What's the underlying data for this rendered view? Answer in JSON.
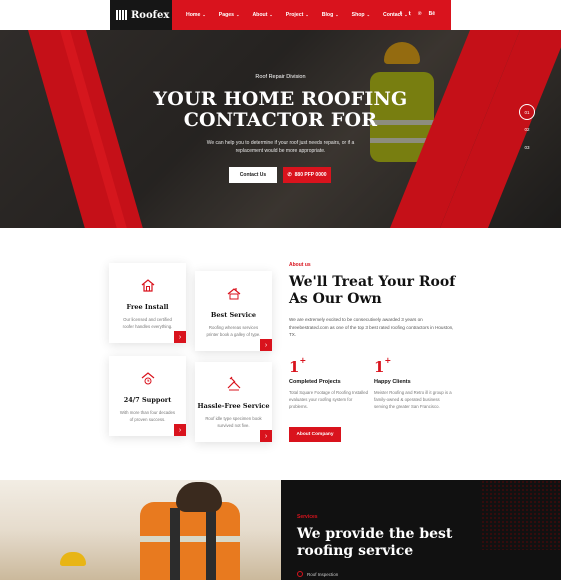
{
  "brand": {
    "name": "Roofex",
    "accent": "#d9131d"
  },
  "nav": {
    "items": [
      {
        "label": "Home"
      },
      {
        "label": "Pages"
      },
      {
        "label": "About"
      },
      {
        "label": "Project"
      },
      {
        "label": "Blog"
      },
      {
        "label": "Shop"
      },
      {
        "label": "Contact"
      }
    ],
    "social": [
      {
        "icon": "facebook-icon",
        "glyph": "f"
      },
      {
        "icon": "twitter-icon",
        "glyph": "𝕥"
      },
      {
        "icon": "pinterest-icon",
        "glyph": "℗"
      },
      {
        "icon": "behance-icon",
        "glyph": "Bē"
      }
    ]
  },
  "hero": {
    "eyebrow": "Roof Repair Division",
    "title_line1": "YOUR HOME ROOFING",
    "title_line2": "CONTACTOR FOR",
    "description": "We can help you to determine if your roof just needs repairs, or if a replacement would be more appropriate.",
    "contact_label": "Contact Us",
    "phone_label": "880 PFP 0000",
    "slides": [
      "01",
      "02",
      "03"
    ]
  },
  "features": [
    {
      "title": "Free Install",
      "text": "Our licensed and certified roofer handles everything.",
      "icon": "house-tools-icon"
    },
    {
      "title": "Best Service",
      "text": "Roofing whereas services printer book a galley of type.",
      "icon": "roof-service-icon"
    },
    {
      "title": "24/7 Support",
      "text": "With more than four decades of proven success.",
      "icon": "support-house-icon"
    },
    {
      "title": "Hassle-Free Service",
      "text": "Roof idle type specimen book survived not five.",
      "icon": "roof-hammer-icon"
    }
  ],
  "about": {
    "eyebrow": "About us",
    "title_line1": "We'll Treat Your Roof",
    "title_line2": "As Our Own",
    "description": "We are extremely excited to be consecutively awarded 3 years on threebestrated.com as one of the top 3 best rated roofing contractors in Houston, TX.",
    "stats": [
      {
        "number": "1",
        "sup": "+",
        "label": "Completed Projects",
        "text": "Total Square Footage of Roofing Installed evaluates your roofing system for problems."
      },
      {
        "number": "1",
        "sup": "+",
        "label": "Happy Clients",
        "text": "Meister Roofing and Retro ill it group is a family-owned & operated business serving the greater San Francisco."
      }
    ],
    "button_label": "About Company"
  },
  "services": {
    "eyebrow": "Services",
    "title_line1": "We provide the best",
    "title_line2": "roofing service",
    "first_item": "Roof Inspection"
  }
}
